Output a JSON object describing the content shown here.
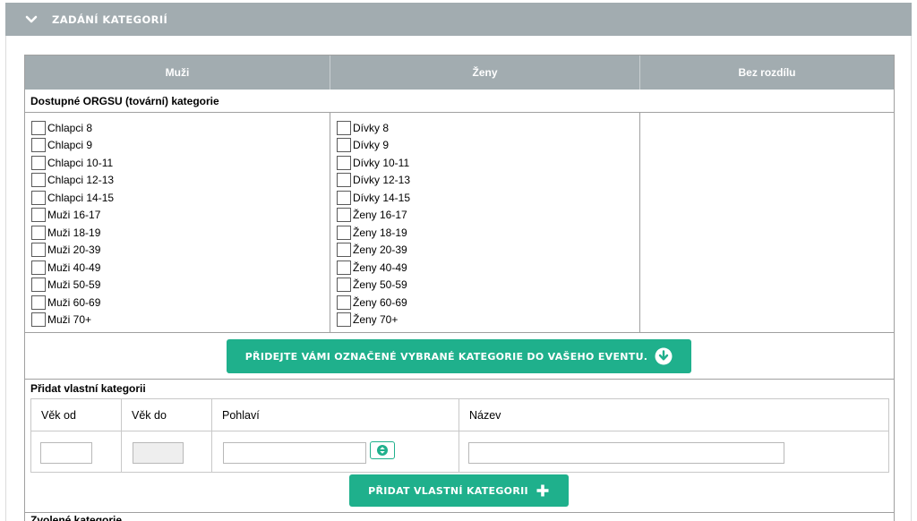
{
  "panel": {
    "title": "ZADÁNÍ KATEGORIÍ"
  },
  "table_header": {
    "men": "Muži",
    "women": "Ženy",
    "none": "Bez rozdílu"
  },
  "available_section": {
    "label": "Dostupné ORGSU (tovární) kategorie"
  },
  "men_categories": [
    "Chlapci 8",
    "Chlapci 9",
    "Chlapci 10-11",
    "Chlapci 12-13",
    "Chlapci 14-15",
    "Muži 16-17",
    "Muži 18-19",
    "Muži 20-39",
    "Muži 40-49",
    "Muži 50-59",
    "Muži 60-69",
    "Muži 70+"
  ],
  "women_categories": [
    "Dívky 8",
    "Dívky 9",
    "Dívky 10-11",
    "Dívky 12-13",
    "Dívky 14-15",
    "Ženy 16-17",
    "Ženy 18-19",
    "Ženy 20-39",
    "Ženy 40-49",
    "Ženy 50-59",
    "Ženy 60-69",
    "Ženy 70+"
  ],
  "add_selected_button": {
    "label": "PŘIDEJTE VÁMI OZNAČENÉ VYBRANÉ KATEGORIE DO VAŠEHO EVENTU."
  },
  "custom_section": {
    "label": "Přidat vlastní kategorii",
    "columns": {
      "age_from": "Věk od",
      "age_to": "Věk do",
      "gender": "Pohlaví",
      "name": "Název"
    },
    "values": {
      "age_from": "",
      "age_to": "",
      "gender": "",
      "name": ""
    }
  },
  "add_custom_button": {
    "label": "PŘIDAT VLASTNÍ KATEGORII"
  },
  "next_section": {
    "label": "Zvolené kategorie"
  },
  "colors": {
    "header_bg": "#a2acb0",
    "accent": "#1fb08c"
  }
}
